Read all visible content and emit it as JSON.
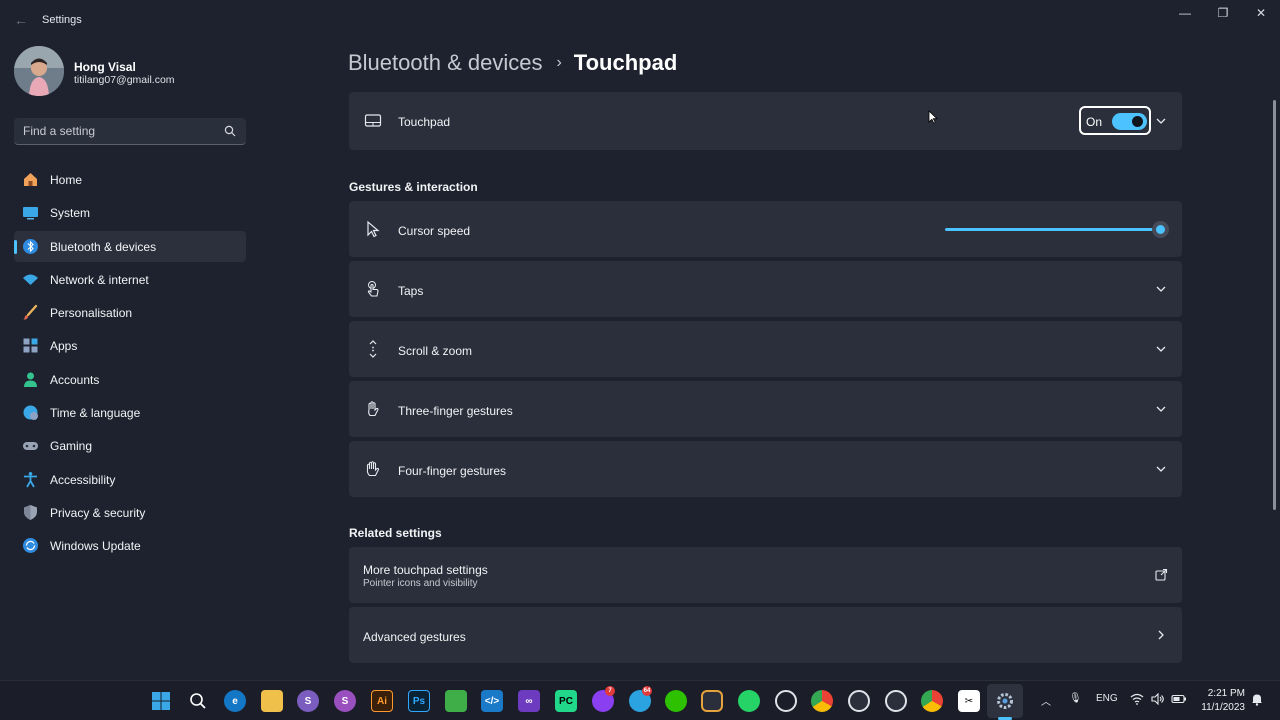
{
  "window": {
    "title": "Settings"
  },
  "profile": {
    "name": "Hong Visal",
    "email": "titilang07@gmail.com"
  },
  "search": {
    "placeholder": "Find a setting"
  },
  "sidebar": {
    "items": [
      {
        "label": "Home",
        "icon": "home-icon"
      },
      {
        "label": "System",
        "icon": "system-icon"
      },
      {
        "label": "Bluetooth & devices",
        "icon": "bluetooth-icon",
        "active": true
      },
      {
        "label": "Network & internet",
        "icon": "wifi-icon"
      },
      {
        "label": "Personalisation",
        "icon": "brush-icon"
      },
      {
        "label": "Apps",
        "icon": "apps-icon"
      },
      {
        "label": "Accounts",
        "icon": "account-icon"
      },
      {
        "label": "Time & language",
        "icon": "globe-icon"
      },
      {
        "label": "Gaming",
        "icon": "gamepad-icon"
      },
      {
        "label": "Accessibility",
        "icon": "accessibility-icon"
      },
      {
        "label": "Privacy & security",
        "icon": "shield-icon"
      },
      {
        "label": "Windows Update",
        "icon": "update-icon"
      }
    ]
  },
  "breadcrumb": {
    "parent": "Bluetooth & devices",
    "separator": "›",
    "current": "Touchpad"
  },
  "touchpad": {
    "label": "Touchpad",
    "state_label": "On",
    "enabled": true
  },
  "gestures": {
    "title": "Gestures & interaction",
    "cursor_speed": {
      "label": "Cursor speed",
      "value_fraction": 1.0
    },
    "rows": [
      {
        "label": "Taps",
        "icon": "tap-icon"
      },
      {
        "label": "Scroll & zoom",
        "icon": "scroll-icon"
      },
      {
        "label": "Three-finger gestures",
        "icon": "three-finger-icon"
      },
      {
        "label": "Four-finger gestures",
        "icon": "four-finger-icon"
      }
    ]
  },
  "related": {
    "title": "Related settings",
    "more": {
      "label": "More touchpad settings",
      "sub": "Pointer icons and visibility"
    },
    "advanced": {
      "label": "Advanced gestures"
    }
  },
  "taskbar": {
    "language": "ENG",
    "time": "2:21 PM",
    "date": "11/1/2023",
    "badges": {
      "messenger": "7",
      "telegram": "64"
    }
  },
  "colors": {
    "accent": "#4cc2ff",
    "background": "#1d222e",
    "card": "#2a2f3b"
  }
}
